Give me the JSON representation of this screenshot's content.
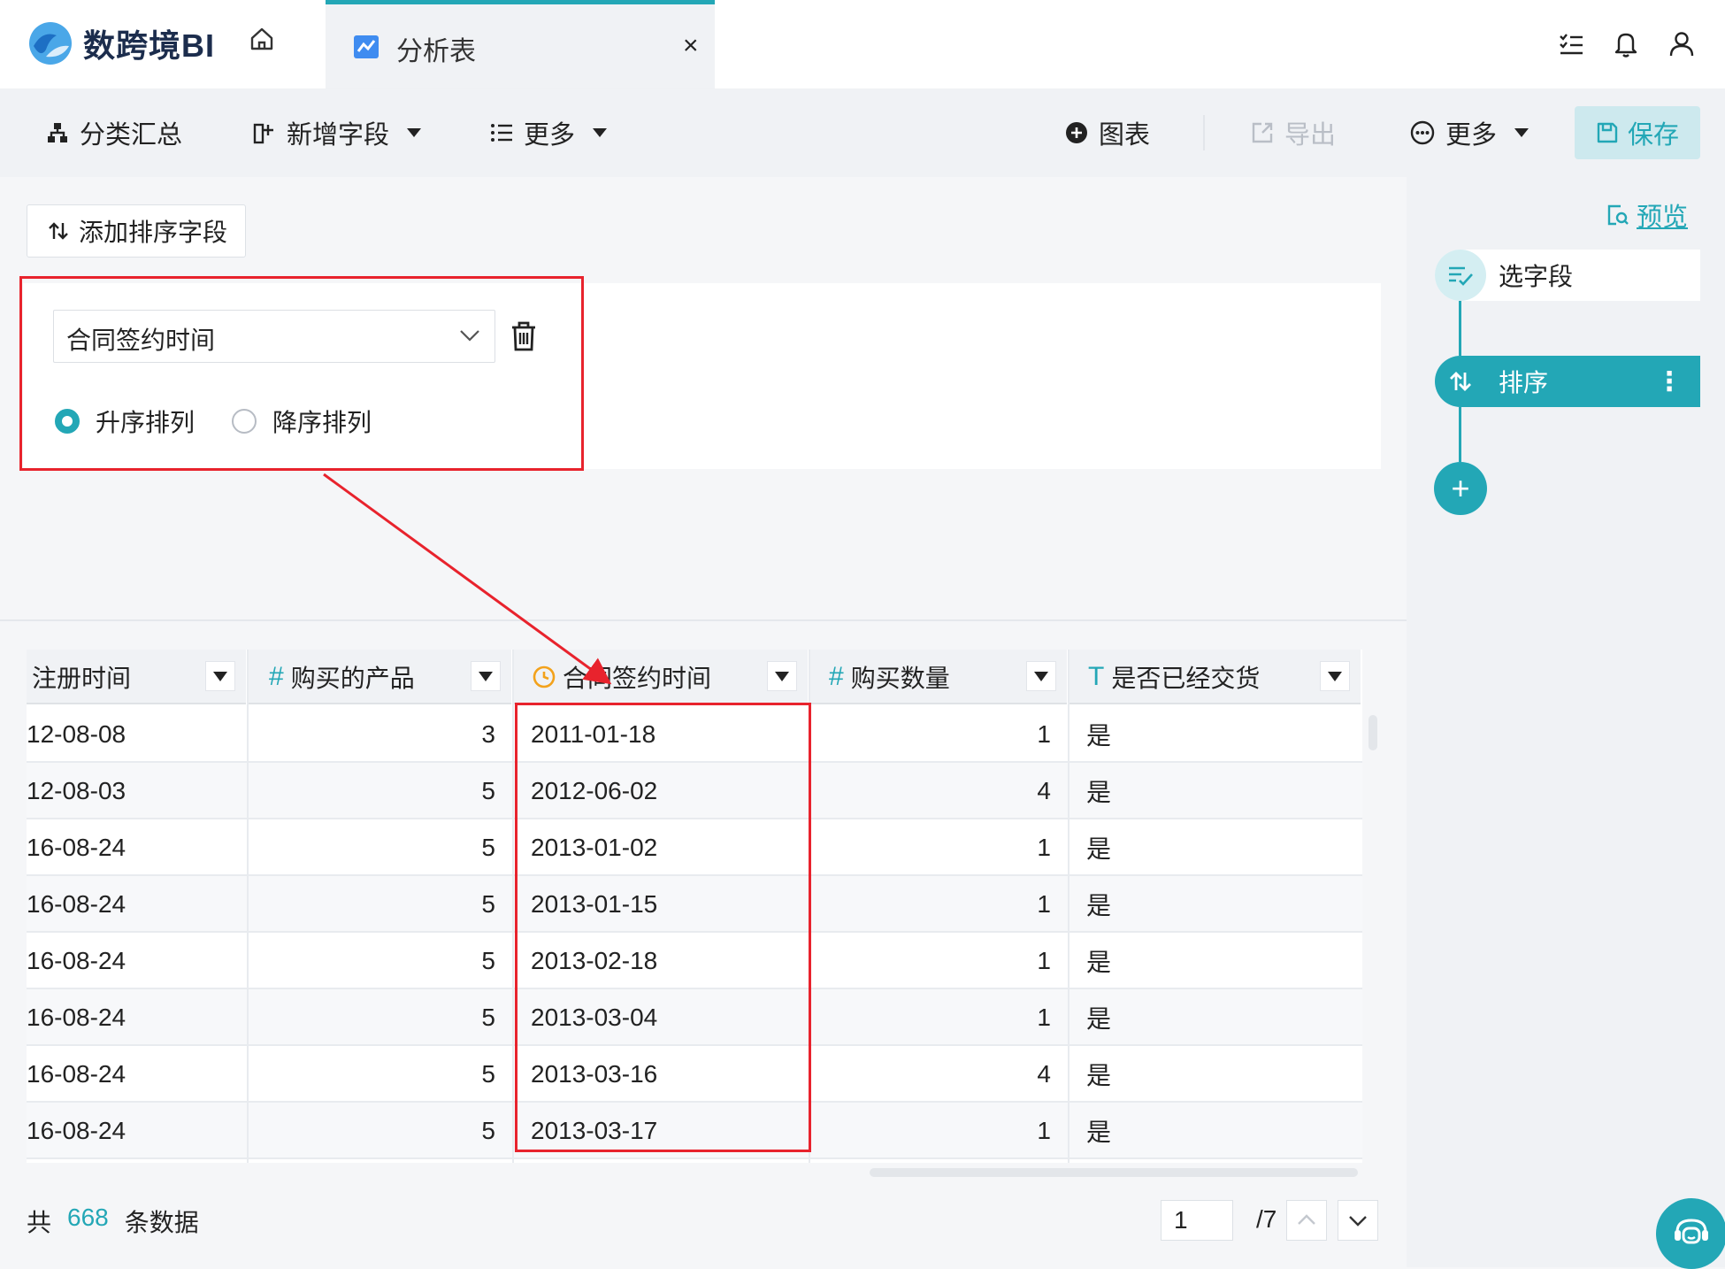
{
  "app": {
    "logo_text": "数跨境BI",
    "tab_label": "分析表",
    "tab_close": "×"
  },
  "toolbar": {
    "group_summary": "分类汇总",
    "add_field": "新增字段",
    "more_left": "更多",
    "chart": "图表",
    "export": "导出",
    "more_right": "更多",
    "save": "保存"
  },
  "sort_panel": {
    "add_sort_label": "添加排序字段",
    "field_value": "合同签约时间",
    "asc_label": "升序排列",
    "desc_label": "降序排列",
    "selected": "asc"
  },
  "flow": {
    "preview": "预览",
    "step_select": "选字段",
    "step_sort": "排序",
    "add": "+"
  },
  "table": {
    "columns": [
      {
        "name": "注册时间",
        "type": "",
        "align": "l"
      },
      {
        "name": "购买的产品",
        "type": "#",
        "align": "r"
      },
      {
        "name": "合同签约时间",
        "type": "clock",
        "align": "l"
      },
      {
        "name": "购买数量",
        "type": "#",
        "align": "r"
      },
      {
        "name": "是否已经交货",
        "type": "T",
        "align": "l"
      }
    ],
    "rows": [
      [
        "12-08-08",
        "3",
        "2011-01-18",
        "1",
        "是"
      ],
      [
        "12-08-03",
        "5",
        "2012-06-02",
        "4",
        "是"
      ],
      [
        "16-08-24",
        "5",
        "2013-01-02",
        "1",
        "是"
      ],
      [
        "16-08-24",
        "5",
        "2013-01-15",
        "1",
        "是"
      ],
      [
        "16-08-24",
        "5",
        "2013-02-18",
        "1",
        "是"
      ],
      [
        "16-08-24",
        "5",
        "2013-03-04",
        "1",
        "是"
      ],
      [
        "16-08-24",
        "5",
        "2013-03-16",
        "4",
        "是"
      ],
      [
        "16-08-24",
        "5",
        "2013-03-17",
        "1",
        "是"
      ]
    ]
  },
  "footer": {
    "count_prefix": "共",
    "count": "668",
    "count_suffix": "条数据",
    "page": "1",
    "total_pages": "/7"
  },
  "colors": {
    "accent": "#23a7b6",
    "highlight": "#e8232d"
  }
}
